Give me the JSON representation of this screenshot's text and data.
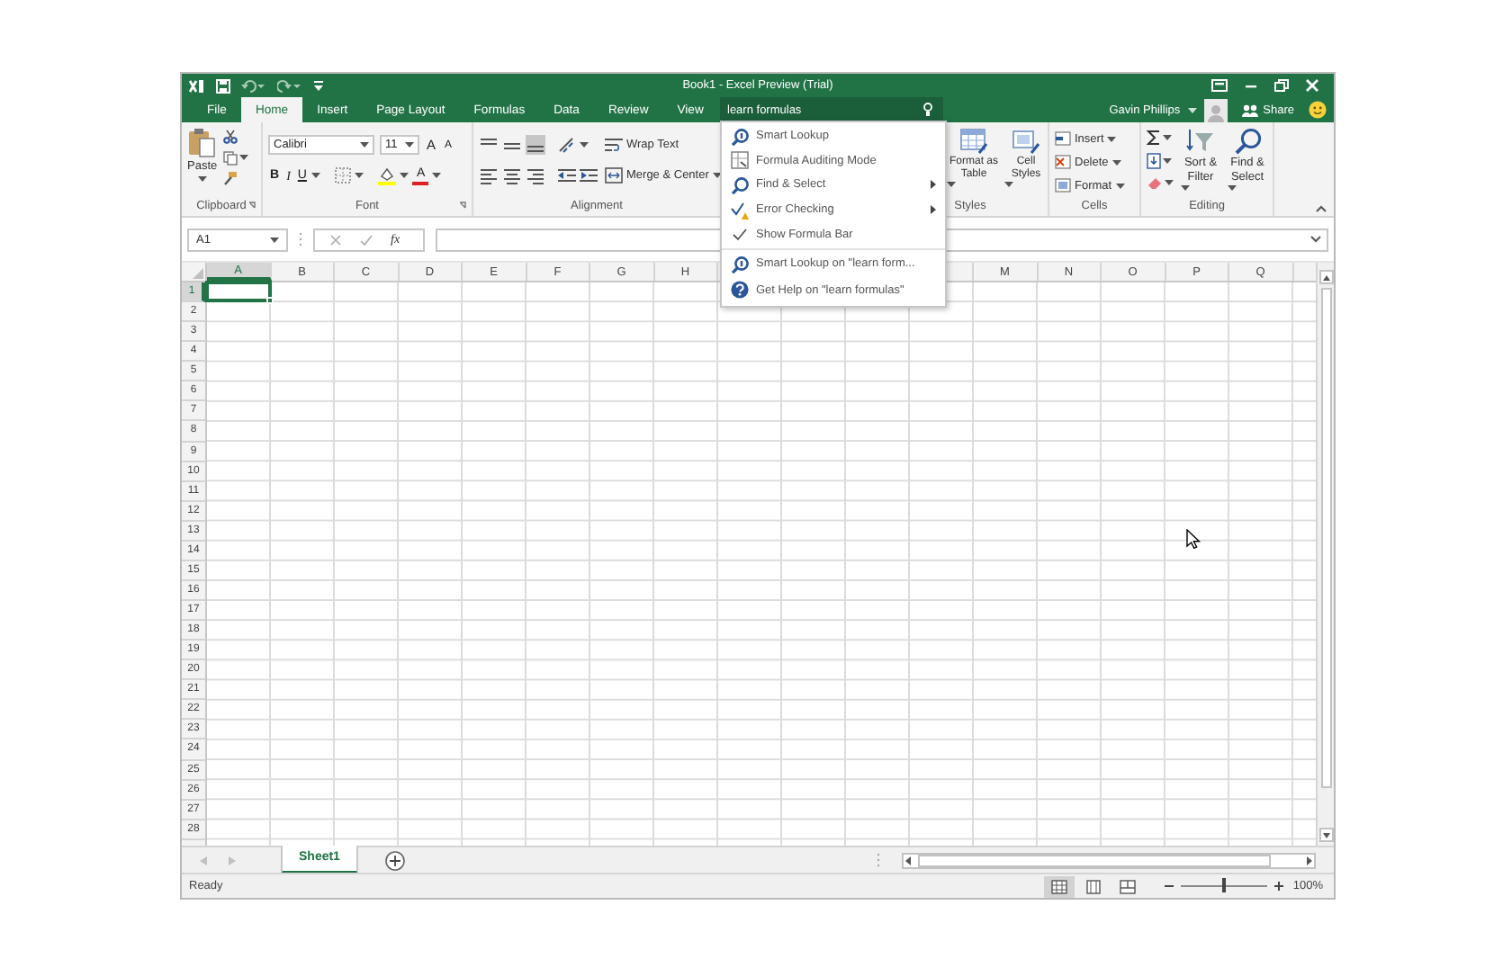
{
  "title_bar": {
    "title": "Book1 - Excel Preview (Trial)"
  },
  "ribbon_tabs": [
    {
      "label": "File",
      "selected": false
    },
    {
      "label": "Home",
      "selected": true
    },
    {
      "label": "Insert",
      "selected": false
    },
    {
      "label": "Page Layout",
      "selected": false
    },
    {
      "label": "Formulas",
      "selected": false
    },
    {
      "label": "Data",
      "selected": false
    },
    {
      "label": "Review",
      "selected": false
    },
    {
      "label": "View",
      "selected": false
    }
  ],
  "tell_me": {
    "value": "learn formulas"
  },
  "account": {
    "user": "Gavin Phillips",
    "share": "Share"
  },
  "ribbon": {
    "clipboard": {
      "paste": "Paste",
      "label": "Clipboard"
    },
    "font": {
      "font_name": "Calibri",
      "font_size": "11",
      "grow": "A",
      "shrink": "A",
      "bold": "B",
      "italic": "I",
      "underline": "U",
      "font_color": "A",
      "label": "Font"
    },
    "alignment": {
      "wrap_text": "Wrap Text",
      "merge_center": "Merge & Center",
      "label": "Alignment"
    },
    "styles": {
      "format_as_table": "Format as Table",
      "cell_styles": "Cell Styles",
      "label": "Styles"
    },
    "cells": {
      "insert": "Insert",
      "delete": "Delete",
      "format": "Format",
      "label": "Cells"
    },
    "editing": {
      "sort_filter": "Sort & Filter",
      "find_select": "Find & Select",
      "label": "Editing"
    }
  },
  "formula_bar": {
    "name_box": "A1",
    "function_label": "fx"
  },
  "columns_left": [
    {
      "label": "A",
      "selected": true
    },
    {
      "label": "B",
      "selected": false
    },
    {
      "label": "C",
      "selected": false
    },
    {
      "label": "D",
      "selected": false
    },
    {
      "label": "E",
      "selected": false
    },
    {
      "label": "F",
      "selected": false
    },
    {
      "label": "G",
      "selected": false
    },
    {
      "label": "H",
      "selected": false
    }
  ],
  "columns_right": [
    {
      "label": "M",
      "selected": false
    },
    {
      "label": "N",
      "selected": false
    },
    {
      "label": "O",
      "selected": false
    },
    {
      "label": "P",
      "selected": false
    },
    {
      "label": "Q",
      "selected": false
    }
  ],
  "rows": [
    {
      "label": "1",
      "selected": true
    },
    {
      "label": "2",
      "selected": false
    },
    {
      "label": "3",
      "selected": false
    },
    {
      "label": "4",
      "selected": false
    },
    {
      "label": "5",
      "selected": false
    },
    {
      "label": "6",
      "selected": false
    },
    {
      "label": "7",
      "selected": false
    },
    {
      "label": "8",
      "selected": false
    },
    {
      "label": "9",
      "selected": false
    },
    {
      "label": "10",
      "selected": false
    },
    {
      "label": "11",
      "selected": false
    },
    {
      "label": "12",
      "selected": false
    },
    {
      "label": "13",
      "selected": false
    },
    {
      "label": "14",
      "selected": false
    },
    {
      "label": "15",
      "selected": false
    },
    {
      "label": "16",
      "selected": false
    },
    {
      "label": "17",
      "selected": false
    },
    {
      "label": "18",
      "selected": false
    },
    {
      "label": "19",
      "selected": false
    },
    {
      "label": "20",
      "selected": false
    },
    {
      "label": "21",
      "selected": false
    },
    {
      "label": "22",
      "selected": false
    },
    {
      "label": "23",
      "selected": false
    },
    {
      "label": "24",
      "selected": false
    },
    {
      "label": "25",
      "selected": false
    },
    {
      "label": "26",
      "selected": false
    },
    {
      "label": "27",
      "selected": false
    },
    {
      "label": "28",
      "selected": false
    }
  ],
  "menu": {
    "items": [
      {
        "label": "Smart Lookup",
        "kind": "lookup",
        "submenu": false,
        "separator_before": false
      },
      {
        "label": "Formula Auditing Mode",
        "kind": "audit",
        "submenu": false,
        "separator_before": false
      },
      {
        "label": "Find & Select",
        "kind": "find",
        "submenu": true,
        "separator_before": false
      },
      {
        "label": "Error Checking",
        "kind": "error",
        "submenu": true,
        "separator_before": false
      },
      {
        "label": "Show Formula Bar",
        "kind": "check",
        "submenu": false,
        "separator_before": false
      },
      {
        "label": "Smart Lookup on \"learn form...",
        "kind": "lookup",
        "submenu": false,
        "separator_before": true
      },
      {
        "label": "Get Help on \"learn formulas\"",
        "kind": "help",
        "submenu": false,
        "separator_before": false
      }
    ]
  },
  "sheet_tabs": [
    {
      "label": "Sheet1",
      "selected": true
    }
  ],
  "status_bar": {
    "status": "Ready",
    "zoom": "100%"
  },
  "view_buttons": [
    {
      "kind": "normal",
      "selected": true
    },
    {
      "kind": "page_layout",
      "selected": false
    },
    {
      "kind": "page_break",
      "selected": false
    }
  ],
  "zoom_slider": {
    "level": 0.5
  }
}
